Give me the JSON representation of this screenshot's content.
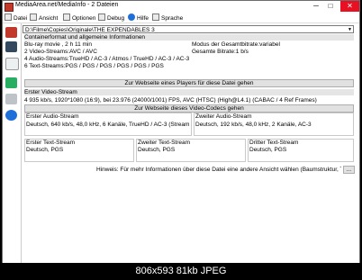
{
  "window": {
    "title": "MediaArea.net/MediaInfo - 2 Dateien",
    "minimize": "─",
    "maximize": "□",
    "close": "✕"
  },
  "menu": {
    "items": [
      "Datei",
      "Ansicht",
      "Optionen",
      "Debug",
      "Hilfe",
      "Sprache"
    ]
  },
  "file_path": "D:\\Filme\\Copies\\Originale\\THE EXPENDABLES 3",
  "general": {
    "header": "Containerformat und allgemeine Informationen",
    "lines": [
      "Blu-ray movie , 2 h 11 min",
      "2 Video-Streams:AVC / AVC",
      "4 Audio-Streams:TrueHD / AC-3 / Atmos / TrueHD / AC-3 / AC-3",
      "6 Text-Streams:PGS / PGS / PGS / PGS / PGS / PGS"
    ],
    "right_lines": [
      "Modus der Gesamtbitrate:variabel",
      "Gesamte Bitrate:1 b/s"
    ]
  },
  "buttons": {
    "player": "Zur Webseite eines Players für diese Datei gehen",
    "codec": "Zur Webseite dieses Video-Codecs gehen",
    "more": "..."
  },
  "video": {
    "header": "Erster Video-Stream",
    "line": "4 935 kb/s, 1920*1080 (16:9), bei 23.976 (24000/1001) FPS, AVC (HTSC) (High@L4.1) (CABAC / 4 Ref Frames)"
  },
  "audio1": {
    "header": "Erster Audio-Stream",
    "line": "Deutsch, 640 kb/s, 48,0 kHz, 6 Kanäle, TrueHD / AC-3 (Stream.exten"
  },
  "audio2": {
    "header": "Zweiter Audio-Stream",
    "line": "Deutsch, 192 kb/s, 48,0 kHz, 2 Kanäle, AC-3"
  },
  "text1": {
    "header": "Erster Text-Stream",
    "line": "Deutsch, PGS"
  },
  "text2": {
    "header": "Zweiter Text-Stream",
    "line": "Deutsch, PGS"
  },
  "text3": {
    "header": "Dritter Text-Stream",
    "line": "Deutsch, PGS"
  },
  "hint": "Hinweis: Für mehr Informationen über diese Datei eine andere Ansicht wählen (Baumstruktur, Tabelle...)",
  "caption": "806x593  81kb  JPEG",
  "colors": {
    "close_red": "#e81123",
    "accent_blue": "#1e6fd9",
    "section_gray": "#e5e5e5"
  }
}
